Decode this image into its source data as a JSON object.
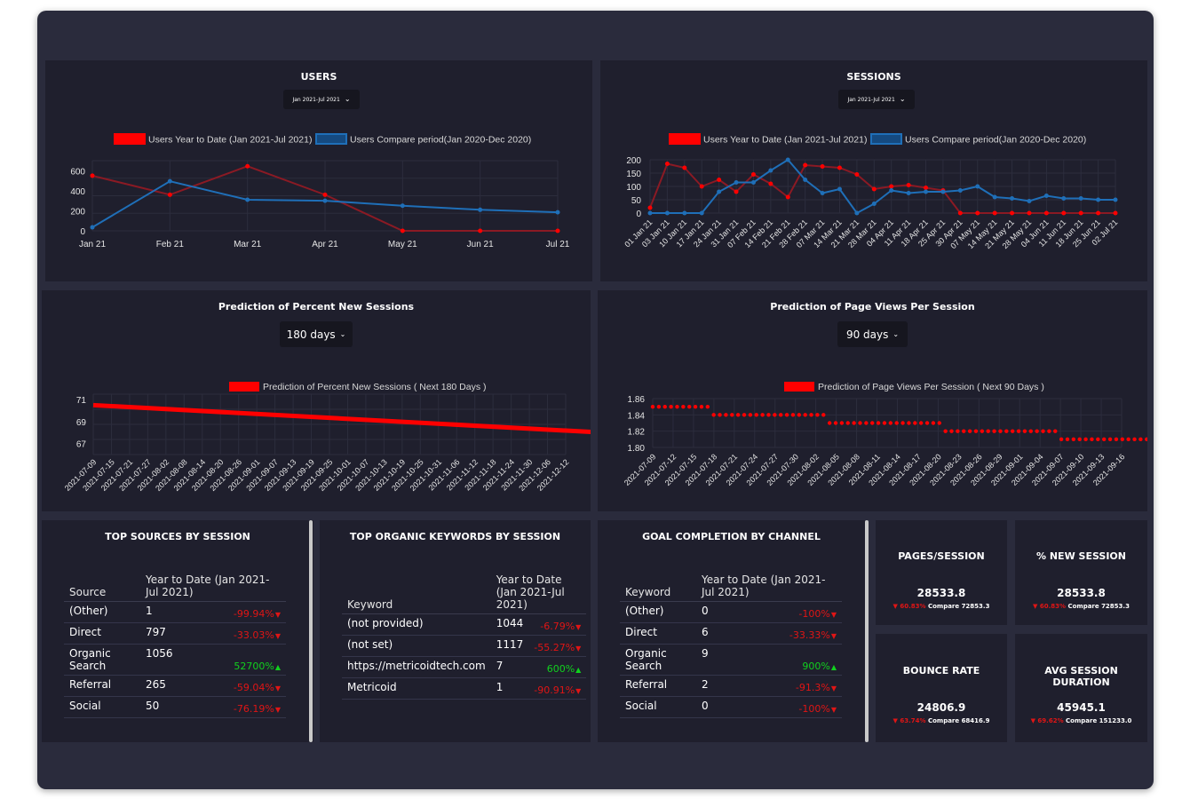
{
  "colors": {
    "red": "#ff0000",
    "red_line": "#8b1a24",
    "blue": "#1f6fb8",
    "bg": "#1f1f2d",
    "neg": "#e01515",
    "pos": "#11d11e"
  },
  "users": {
    "title": "USERS",
    "dropdown": "Jan 2021-Jul 2021",
    "chart_data": {
      "type": "line",
      "categories": [
        "Jan 21",
        "Feb 21",
        "Mar 21",
        "Apr 21",
        "May 21",
        "Jun 21",
        "Jul 21"
      ],
      "series": [
        {
          "name": "Users Year to Date  (Jan 2021-Jul 2021)",
          "values": [
            550,
            360,
            645,
            360,
            0,
            0,
            0
          ]
        },
        {
          "name": "Users Compare period(Jan 2020-Dec 2020)",
          "values": [
            35,
            495,
            310,
            300,
            250,
            210,
            185
          ]
        }
      ],
      "yticks": [
        0,
        200,
        400,
        600
      ],
      "ylim": [
        0,
        700
      ]
    }
  },
  "sessions": {
    "title": "SESSIONS",
    "dropdown": "Jan 2021-Jul 2021",
    "chart_data": {
      "type": "line",
      "categories": [
        "01 Jan 21",
        "03 Jan 21",
        "10 Jan 21",
        "17 Jan 21",
        "24 Jan 21",
        "31 Jan 21",
        "07 Feb 21",
        "14 Feb 21",
        "21 Feb 21",
        "28 Feb 21",
        "07 Mar 21",
        "14 Mar 21",
        "21 Mar 21",
        "28 Mar 21",
        "04 Apr 21",
        "11 Apr 21",
        "18 Apr 21",
        "25 Apr 21",
        "30 Apr 21",
        "07 May 21",
        "14 May 21",
        "21 May 21",
        "28 May 21",
        "04 Jun 21",
        "11 Jun 21",
        "18 Jun 21",
        "25 Jun 21",
        "02 Jul 21"
      ],
      "series": [
        {
          "name": "Users Year to Date  (Jan 2021-Jul 2021)",
          "values": [
            20,
            185,
            170,
            100,
            125,
            80,
            145,
            110,
            60,
            180,
            175,
            170,
            145,
            90,
            100,
            105,
            95,
            85,
            0,
            0,
            0,
            0,
            0,
            0,
            0,
            0,
            0,
            0
          ]
        },
        {
          "name": "Users Compare period(Jan 2020-Dec 2020)",
          "values": [
            0,
            0,
            0,
            0,
            80,
            115,
            115,
            160,
            200,
            125,
            75,
            90,
            0,
            35,
            85,
            75,
            80,
            80,
            85,
            100,
            60,
            55,
            45,
            65,
            55,
            55,
            50,
            50
          ]
        }
      ],
      "yticks": [
        0,
        50,
        100,
        150,
        200
      ],
      "ylim": [
        0,
        200
      ]
    }
  },
  "percent_new": {
    "title": "Prediction of Percent New Sessions",
    "dropdown": "180 days",
    "chart_data": {
      "type": "line",
      "legend": "Prediction of Percent New Sessions ( Next 180 Days )",
      "categories": [
        "2021-07-09",
        "2021-07-15",
        "2021-07-21",
        "2021-07-27",
        "2021-08-02",
        "2021-08-08",
        "2021-08-14",
        "2021-08-20",
        "2021-08-26",
        "2021-09-01",
        "2021-09-07",
        "2021-09-13",
        "2021-09-19",
        "2021-09-25",
        "2021-10-01",
        "2021-10-07",
        "2021-10-13",
        "2021-10-19",
        "2021-10-25",
        "2021-10-31",
        "2021-11-06",
        "2021-11-12",
        "2021-11-18",
        "2021-11-24",
        "2021-11-30",
        "2021-12-06",
        "2021-12-12"
      ],
      "start": 70.5,
      "end": 68.0,
      "yticks": [
        67,
        69,
        71
      ],
      "ylim": [
        66,
        71.5
      ]
    }
  },
  "pageviews": {
    "title": "Prediction of Page Views Per Session",
    "dropdown": "90 days",
    "chart_data": {
      "type": "line",
      "legend": "Prediction of Page Views Per Session ( Next 90 Days )",
      "categories": [
        "2021-07-09",
        "2021-07-12",
        "2021-07-15",
        "2021-07-18",
        "2021-07-21",
        "2021-07-24",
        "2021-07-27",
        "2021-07-30",
        "2021-08-02",
        "2021-08-05",
        "2021-08-08",
        "2021-08-11",
        "2021-08-14",
        "2021-08-17",
        "2021-08-20",
        "2021-08-23",
        "2021-08-26",
        "2021-08-29",
        "2021-09-01",
        "2021-09-04",
        "2021-09-07",
        "2021-09-10",
        "2021-09-13",
        "2021-09-16"
      ],
      "steps": [
        {
          "count": 10,
          "value": 1.85
        },
        {
          "count": 19,
          "value": 1.84
        },
        {
          "count": 19,
          "value": 1.83
        },
        {
          "count": 19,
          "value": 1.82
        },
        {
          "count": 17,
          "value": 1.81
        }
      ],
      "yticks": [
        1.8,
        1.82,
        1.84,
        1.86
      ],
      "ylim": [
        1.8,
        1.86
      ]
    }
  },
  "sources": {
    "title": "TOP SOURCES BY SESSION",
    "col1": "Source",
    "col2": "Year to Date (Jan 2021-Jul 2021)",
    "rows": [
      {
        "name": "(Other)",
        "value": "1",
        "change": "-99.94%",
        "dir": "down"
      },
      {
        "name": "Direct",
        "value": "797",
        "change": "-33.03%",
        "dir": "down"
      },
      {
        "name": "Organic Search",
        "value": "1056",
        "change": "52700%",
        "dir": "up"
      },
      {
        "name": "Referral",
        "value": "265",
        "change": "-59.04%",
        "dir": "down"
      },
      {
        "name": "Social",
        "value": "50",
        "change": "-76.19%",
        "dir": "down"
      }
    ]
  },
  "keywords": {
    "title": "TOP ORGANIC KEYWORDS BY SESSION",
    "col1": "Keyword",
    "col2": "Year to Date (Jan 2021-Jul 2021)",
    "rows": [
      {
        "name": "(not provided)",
        "value": "1044",
        "change": "-6.79%",
        "dir": "down"
      },
      {
        "name": "(not set)",
        "value": "1117",
        "change": "-55.27%",
        "dir": "down"
      },
      {
        "name": "https://metricoidtech.com",
        "value": "7",
        "change": "600%",
        "dir": "up"
      },
      {
        "name": "Metricoid",
        "value": "1",
        "change": "-90.91%",
        "dir": "down"
      }
    ]
  },
  "goals": {
    "title": "GOAL COMPLETION BY CHANNEL",
    "col1": "Keyword",
    "col2": "Year to Date (Jan 2021-Jul 2021)",
    "rows": [
      {
        "name": "(Other)",
        "value": "0",
        "change": "-100%",
        "dir": "down"
      },
      {
        "name": "Direct",
        "value": "6",
        "change": "-33.33%",
        "dir": "down"
      },
      {
        "name": "Organic Search",
        "value": "9",
        "change": "900%",
        "dir": "up"
      },
      {
        "name": "Referral",
        "value": "2",
        "change": "-91.3%",
        "dir": "down"
      },
      {
        "name": "Social",
        "value": "0",
        "change": "-100%",
        "dir": "down"
      }
    ]
  },
  "kpis": [
    {
      "title": "PAGES/SESSION",
      "value": "28533.8",
      "pct": "60.83%",
      "compare": "Compare 72853.3"
    },
    {
      "title": "% NEW SESSION",
      "value": "28533.8",
      "pct": "60.83%",
      "compare": "Compare 72853.3"
    },
    {
      "title": "BOUNCE RATE",
      "value": "24806.9",
      "pct": "63.74%",
      "compare": "Compare 68416.9"
    },
    {
      "title": "AVG SESSION DURATION",
      "value": "45945.1",
      "pct": "69.62%",
      "compare": "Compare 151233.0"
    }
  ]
}
